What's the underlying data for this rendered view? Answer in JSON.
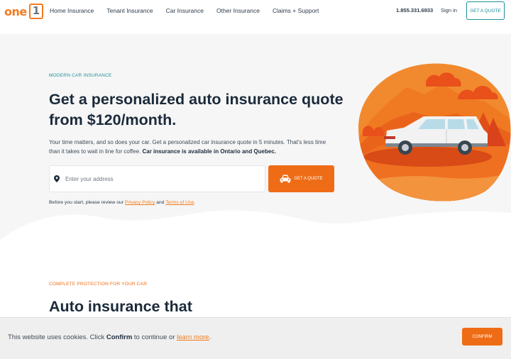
{
  "header": {
    "logo_text": "one",
    "logo_mark": "1",
    "nav": [
      "Home Insurance",
      "Tenant Insurance",
      "Car Insurance",
      "Other Insurance",
      "Claims + Support"
    ],
    "phone": "1.855.331.6933",
    "signin": "Sign in",
    "quote_button": "GET A QUOTE"
  },
  "hero": {
    "eyebrow": "MODERN CAR INSURANCE",
    "headline": "Get a personalized auto insurance quote from $120/month.",
    "desc_plain": "Your time matters, and so does your car. Get a personalized car insurance quote in 5 minutes. That's less time than it takes to wait in line for coffee. ",
    "desc_bold": "Car insurance is available in Ontario and Quebec.",
    "address_placeholder": "Enter your address",
    "quote_button": "GET A QUOTE",
    "disclaimer_pre": "Before you start, please review our ",
    "privacy_link": "Privacy Policy",
    "disclaimer_and": " and ",
    "terms_link": "Terms of Use",
    "disclaimer_end": "."
  },
  "section2": {
    "eyebrow": "COMPLETE PROTECTION FOR YOUR CAR",
    "headline": "Auto insurance that"
  },
  "cookie": {
    "text_pre": "This website uses cookies. Click ",
    "text_bold": "Confirm",
    "text_mid": " to continue or ",
    "link": "learn more",
    "text_end": ".",
    "button": "CONFIRM"
  },
  "colors": {
    "accent": "#ef6c16",
    "teal": "#1d8f9c",
    "text": "#1b2a3a"
  }
}
